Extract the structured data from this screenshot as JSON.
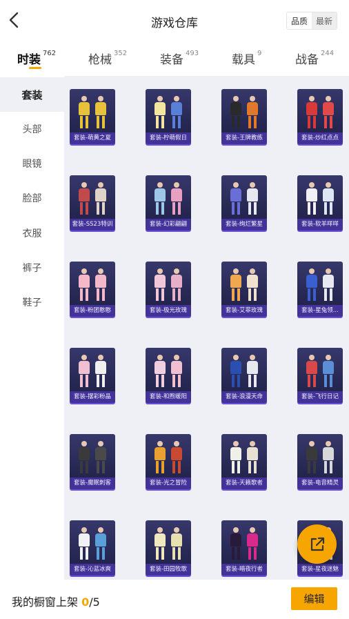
{
  "header": {
    "title": "游戏仓库",
    "sort_options": [
      "品质",
      "最新"
    ]
  },
  "categories": [
    {
      "label": "时装",
      "count": "762",
      "active": true
    },
    {
      "label": "枪械",
      "count": "352",
      "active": false
    },
    {
      "label": "装备",
      "count": "493",
      "active": false
    },
    {
      "label": "载具",
      "count": "9",
      "active": false
    },
    {
      "label": "战备",
      "count": "244",
      "active": false
    }
  ],
  "sidebar": {
    "items": [
      "套装",
      "头部",
      "眼镜",
      "脸部",
      "衣服",
      "裤子",
      "鞋子"
    ],
    "active_index": 0
  },
  "items": [
    {
      "label": "套装-萌黄之夏",
      "colors": [
        "#e8c23a",
        "#e8c23a"
      ]
    },
    {
      "label": "套装-柠萌假日",
      "colors": [
        "#f2e6a0",
        "#5a7fd6"
      ]
    },
    {
      "label": "套装-王牌教练",
      "colors": [
        "#2a2a2a",
        "#e07a2a"
      ]
    },
    {
      "label": "套装-炒红点点",
      "colors": [
        "#d83a3a",
        "#e04a4a"
      ]
    },
    {
      "label": "套装-SS23特训",
      "colors": [
        "#c24a4a",
        "#e0d4c8"
      ]
    },
    {
      "label": "套装-幻彩翩翩",
      "colors": [
        "#9ec8e8",
        "#e8a0c0"
      ]
    },
    {
      "label": "套装-绚烂繁星",
      "colors": [
        "#6a6fd8",
        "#e8e8f0"
      ]
    },
    {
      "label": "套装-软羊咩咩",
      "colors": [
        "#f0f0f5",
        "#dce6f5"
      ]
    },
    {
      "label": "套装-粉团憨憨",
      "colors": [
        "#f4b8c8",
        "#f4b8c8"
      ]
    },
    {
      "label": "套装-极光玫瑰",
      "colors": [
        "#f2c8d8",
        "#e8b0c8"
      ]
    },
    {
      "label": "套装-艾菲玫瑰",
      "colors": [
        "#f0a850",
        "#f0e0d0"
      ]
    },
    {
      "label": "套装-星兔领...",
      "colors": [
        "#3a5fd0",
        "#e8e8f0"
      ]
    },
    {
      "label": "套装-摆彩粉晶",
      "colors": [
        "#f0c0d0",
        "#f0f0f0"
      ]
    },
    {
      "label": "套装-和煦暖阳",
      "colors": [
        "#f0d0e0",
        "#f0c0d0"
      ]
    },
    {
      "label": "套装-浪漫天命",
      "colors": [
        "#2a4fb0",
        "#e8e8f0"
      ]
    },
    {
      "label": "套装-飞行日记",
      "colors": [
        "#d84a4a",
        "#5a8fd8"
      ]
    },
    {
      "label": "套装-魔眠刺客",
      "colors": [
        "#3a3a3a",
        "#4a4a4a"
      ]
    },
    {
      "label": "套装-光之冒险",
      "colors": [
        "#e8a030",
        "#c84a30"
      ]
    },
    {
      "label": "套装-天籁歌者",
      "colors": [
        "#f0f0e8",
        "#e8e0d0"
      ]
    },
    {
      "label": "套装-电音精灵",
      "colors": [
        "#3a3a3a",
        "#d8d8d8"
      ]
    },
    {
      "label": "套装-沁蓝冰爽",
      "colors": [
        "#f0f0f5",
        "#5aa0d8"
      ]
    },
    {
      "label": "套装-田园牧歌",
      "colors": [
        "#f0e8c0",
        "#e8e0b0"
      ]
    },
    {
      "label": "套装-暗夜行者",
      "colors": [
        "#2a1a3a",
        "#d82a8a"
      ]
    },
    {
      "label": "套装-星夜迷魅",
      "colors": [
        "#3a3a5a",
        "#d8d8e8"
      ]
    }
  ],
  "bottom": {
    "shelf_label": "我的橱窗上架",
    "shelf_current": "0",
    "shelf_total": "/5",
    "edit_label": "编辑"
  },
  "colors": {
    "accent": "#f7a500",
    "card_label_bg": "#4634a0",
    "panel_bg": "#eef0f5"
  },
  "icons": {
    "back": "chevron-left-icon",
    "share": "share-external-icon"
  }
}
